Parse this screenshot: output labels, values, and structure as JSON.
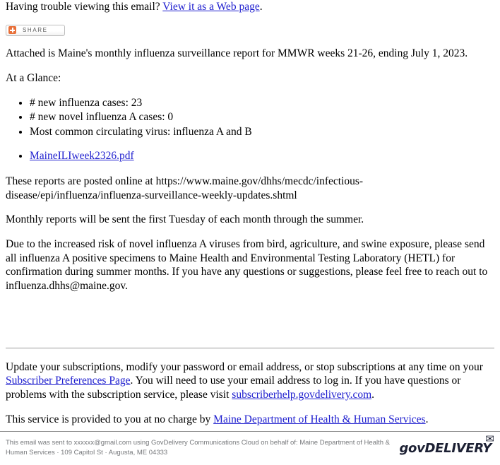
{
  "header": {
    "trouble_text": "Having trouble viewing this email? ",
    "web_page_link": "View it as a Web page",
    "trouble_suffix": "."
  },
  "share_button": {
    "label": "SHARE",
    "icon": "plus-square-icon",
    "icon_color": "#e8703a"
  },
  "body": {
    "lead": "Attached is Maine's monthly influenza surveillance report for MMWR weeks 21-26, ending July 1, 2023.",
    "at_a_glance_heading": "At a Glance:",
    "glance_items": [
      "# new influenza cases: 23",
      "# new novel influenza A cases: 0",
      "Most common circulating virus: influenza A and B"
    ],
    "attachment_link": "MaineILIweek2326.pdf",
    "posted_online": "These reports are posted online at https://www.maine.gov/dhhs/mecdc/infectious-disease/epi/influenza/influenza-surveillance-weekly-updates.shtml",
    "monthly_note": "Monthly reports will be sent the first Tuesday of each month through the summer.",
    "risk_note": "Due to the increased risk of novel influenza A viruses from bird, agriculture, and swine exposure, please send all influenza A positive specimens to Maine Health and Environmental Testing Laboratory (HETL) for confirmation during summer months. If you have any questions or suggestions, please feel free to reach out to influenza.dhhs@maine.gov."
  },
  "footer": {
    "subscriptions_prefix": "Update your subscriptions, modify your password or email address, or stop subscriptions at any time on your ",
    "preferences_link": "Subscriber Preferences Page",
    "subscriptions_middle": ". You will need to use your email address to log in. If you have questions or problems with the subscription service, please visit ",
    "help_link": "subscriberhelp.govdelivery.com",
    "subscriptions_suffix": ".",
    "service_prefix": "This service is provided to you at no charge by ",
    "service_link": "Maine Department of Health & Human Services",
    "service_suffix": "."
  },
  "bottom_bar": {
    "sent_text": "This email was sent to xxxxxx@gmail.com using GovDelivery Communications Cloud on behalf of: Maine Department of Health & Human Services · 109 Capitol St · Augusta, ME 04333",
    "brand_name": "govDELIVERY",
    "brand_icon": "envelope-icon"
  },
  "colors": {
    "link": "#2020cf",
    "accent_orange": "#e8703a",
    "muted_text": "#76787b",
    "rule": "#9a9a9a"
  }
}
